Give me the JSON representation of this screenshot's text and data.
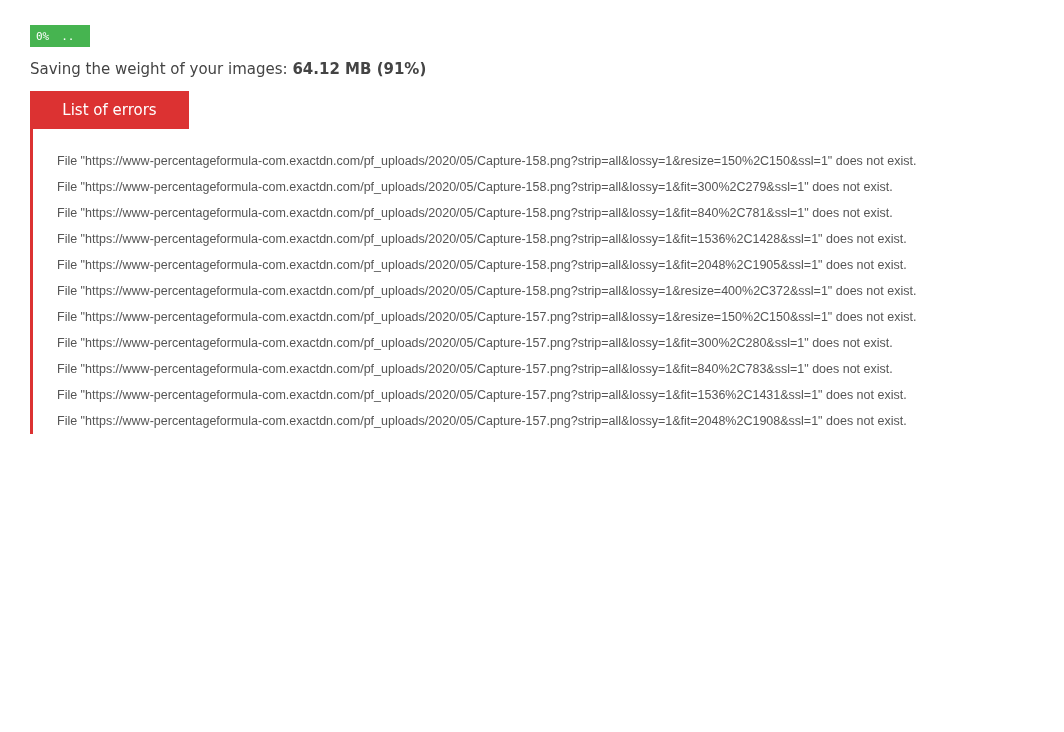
{
  "progress": {
    "percent": "0%",
    "dots": ".."
  },
  "saving": {
    "label": "Saving the weight of your images:",
    "value": "64.12 MB (91%)"
  },
  "errors_panel": {
    "title": "List of errors",
    "errors": [
      "File \"https://www-percentageformula-com.exactdn.com/pf_uploads/2020/05/Capture-158.png?strip=all&lossy=1&resize=150%2C150&ssl=1\" does not exist.",
      "File \"https://www-percentageformula-com.exactdn.com/pf_uploads/2020/05/Capture-158.png?strip=all&lossy=1&fit=300%2C279&ssl=1\" does not exist.",
      "File \"https://www-percentageformula-com.exactdn.com/pf_uploads/2020/05/Capture-158.png?strip=all&lossy=1&fit=840%2C781&ssl=1\" does not exist.",
      "File \"https://www-percentageformula-com.exactdn.com/pf_uploads/2020/05/Capture-158.png?strip=all&lossy=1&fit=1536%2C1428&ssl=1\" does not exist.",
      "File \"https://www-percentageformula-com.exactdn.com/pf_uploads/2020/05/Capture-158.png?strip=all&lossy=1&fit=2048%2C1905&ssl=1\" does not exist.",
      "File \"https://www-percentageformula-com.exactdn.com/pf_uploads/2020/05/Capture-158.png?strip=all&lossy=1&resize=400%2C372&ssl=1\" does not exist.",
      "File \"https://www-percentageformula-com.exactdn.com/pf_uploads/2020/05/Capture-157.png?strip=all&lossy=1&resize=150%2C150&ssl=1\" does not exist.",
      "File \"https://www-percentageformula-com.exactdn.com/pf_uploads/2020/05/Capture-157.png?strip=all&lossy=1&fit=300%2C280&ssl=1\" does not exist.",
      "File \"https://www-percentageformula-com.exactdn.com/pf_uploads/2020/05/Capture-157.png?strip=all&lossy=1&fit=840%2C783&ssl=1\" does not exist.",
      "File \"https://www-percentageformula-com.exactdn.com/pf_uploads/2020/05/Capture-157.png?strip=all&lossy=1&fit=1536%2C1431&ssl=1\" does not exist.",
      "File \"https://www-percentageformula-com.exactdn.com/pf_uploads/2020/05/Capture-157.png?strip=all&lossy=1&fit=2048%2C1908&ssl=1\" does not exist."
    ]
  }
}
